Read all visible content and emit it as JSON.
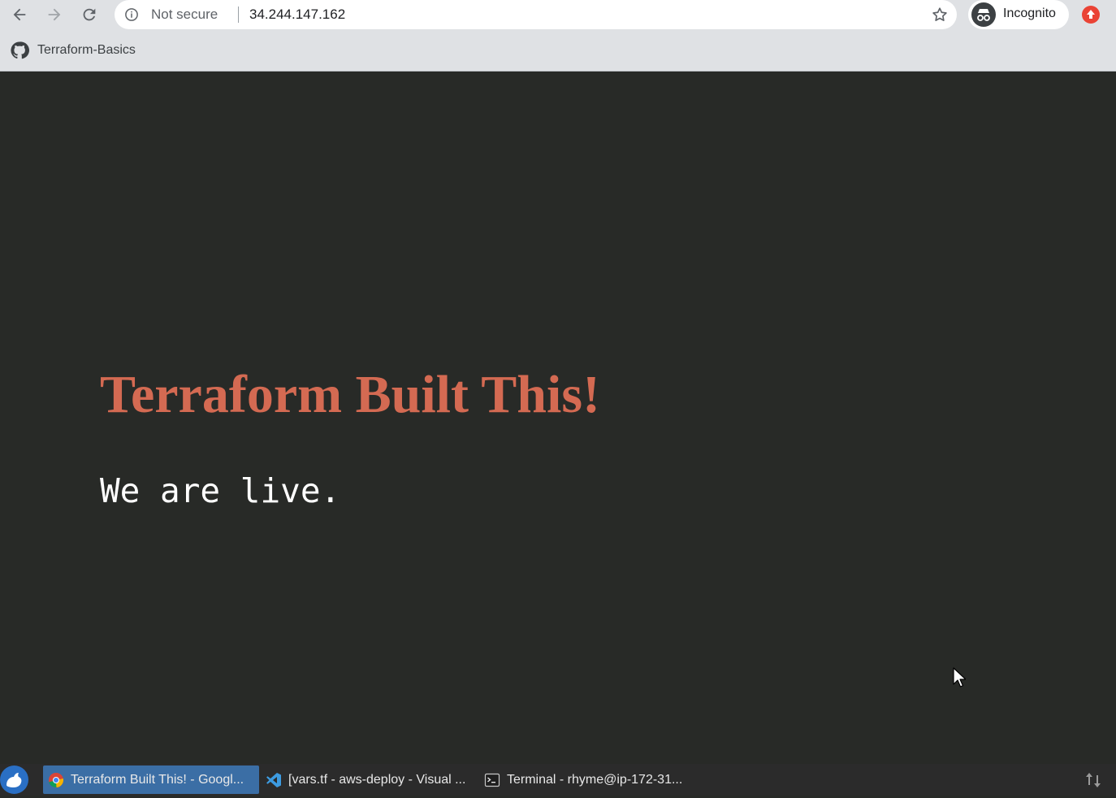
{
  "browser": {
    "security_label": "Not secure",
    "url": "34.244.147.162",
    "profile_label": "Incognito"
  },
  "bookmarks": [
    {
      "label": "Terraform-Basics",
      "icon": "github-icon"
    }
  ],
  "page": {
    "heading": "Terraform Built This!",
    "subheading": "We are live.",
    "colors": {
      "background": "#282a27",
      "heading": "#d46a52",
      "subheading": "#ffffff"
    }
  },
  "taskbar": {
    "tasks": [
      {
        "label": "Terraform Built This! - Googl...",
        "icon": "chrome-icon",
        "active": true
      },
      {
        "label": "[vars.tf - aws-deploy - Visual ...",
        "icon": "vscode-icon",
        "active": false
      },
      {
        "label": "Terminal - rhyme@ip-172-31...",
        "icon": "terminal-icon",
        "active": false
      }
    ]
  }
}
